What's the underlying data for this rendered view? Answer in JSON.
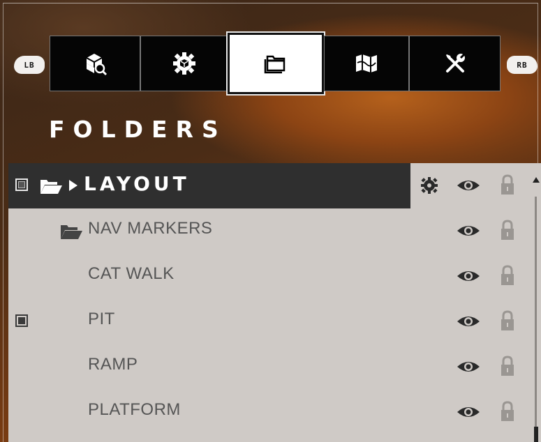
{
  "bumpers": {
    "left": "LB",
    "right": "RB"
  },
  "tabs": [
    {
      "icon": "cube-search-icon",
      "active": false
    },
    {
      "icon": "gear-cube-icon",
      "active": false
    },
    {
      "icon": "folder-icon",
      "active": true
    },
    {
      "icon": "map-icon",
      "active": false
    },
    {
      "icon": "tools-icon",
      "active": false
    }
  ],
  "page_title": "FOLDERS",
  "rows": [
    {
      "label": "LAYOUT",
      "selected": true,
      "checked": true,
      "has_folder": true,
      "expandable": true,
      "indent": 0
    },
    {
      "label": "NAV MARKERS",
      "selected": false,
      "checked": false,
      "has_folder": true,
      "expandable": false,
      "indent": 1
    },
    {
      "label": "CAT WALK",
      "selected": false,
      "checked": false,
      "has_folder": false,
      "indent": 1
    },
    {
      "label": "PIT",
      "selected": false,
      "checked": true,
      "has_folder": false,
      "indent": 1
    },
    {
      "label": "RAMP",
      "selected": false,
      "checked": false,
      "has_folder": false,
      "indent": 1
    },
    {
      "label": "PLATFORM",
      "selected": false,
      "checked": false,
      "has_folder": false,
      "indent": 1
    }
  ],
  "colors": {
    "panel_bg": "#cfcac6",
    "selected_row_bg": "#2f2f2f",
    "text_dim": "#555555",
    "lock_dim": "#9a9692"
  }
}
